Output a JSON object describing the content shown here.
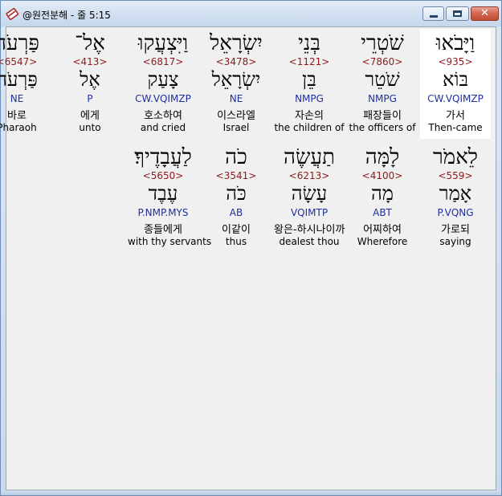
{
  "window": {
    "title": "@원전분해 - 줄 5:15",
    "min_icon": "minimize-icon",
    "max_icon": "maximize-icon",
    "close_icon": "close-icon",
    "close_glyph": "✕"
  },
  "rows": [
    {
      "words": [
        {
          "hebrew": "וַיָּבֹאוּ",
          "strong": "<935>",
          "lemma": "בּוֹא",
          "morph": "CW.VQIMZP",
          "korean": "가서",
          "english": "Then-came",
          "selected": true
        },
        {
          "hebrew": "שֹׁטְרֵי",
          "strong": "<7860>",
          "lemma": "שֹׁטֵר",
          "morph": "NMPG",
          "korean": "패장들이",
          "english": "the officers of"
        },
        {
          "hebrew": "בְּנֵי",
          "strong": "<1121>",
          "lemma": "בֵּן",
          "morph": "NMPG",
          "korean": "자손의",
          "english": "the children of"
        },
        {
          "hebrew": "יִשְׂרָאֵל",
          "strong": "<3478>",
          "lemma": "יִשְׂרָאֵל",
          "morph": "NE",
          "korean": "이스라엘",
          "english": "Israel"
        },
        {
          "hebrew": "וַיִּצְעֲקוּ",
          "strong": "<6817>",
          "lemma": "צָעַק",
          "morph": "CW.VQIMZP",
          "korean": "호소하여",
          "english": "and cried"
        },
        {
          "hebrew": "אֶל־",
          "strong": "<413>",
          "lemma": "אֶל",
          "morph": "P",
          "korean": "에게",
          "english": "unto"
        },
        {
          "hebrew": "פַּרְעֹה",
          "strong": "<6547>",
          "lemma": "פַּרְעֹה",
          "morph": "NE",
          "korean": "바로",
          "english": "Pharaoh"
        }
      ]
    },
    {
      "words": [
        {
          "hebrew": "לֵאמֹר",
          "strong": "<559>",
          "lemma": "אָמַר",
          "morph": "P.VQNG",
          "korean": "가로되",
          "english": "saying"
        },
        {
          "hebrew": "לָמָּה",
          "strong": "<4100>",
          "lemma": "מָה",
          "morph": "ABT",
          "korean": "어찌하여",
          "english": "Wherefore"
        },
        {
          "hebrew": "תַעֲשֶׂה",
          "strong": "<6213>",
          "lemma": "עָשָׂה",
          "morph": "VQIMTP",
          "korean": "왕은-하시나이까",
          "english": "dealest thou"
        },
        {
          "hebrew": "כֹה",
          "strong": "<3541>",
          "lemma": "כֹּה",
          "morph": "AB",
          "korean": "이같이",
          "english": "thus"
        },
        {
          "hebrew": "לַעֲבָדֶיךָ׃",
          "strong": "<5650>",
          "lemma": "עֶבֶד",
          "morph": "P.NMP.MYS",
          "korean": "종들에게",
          "english": "with thy servants"
        }
      ]
    }
  ]
}
